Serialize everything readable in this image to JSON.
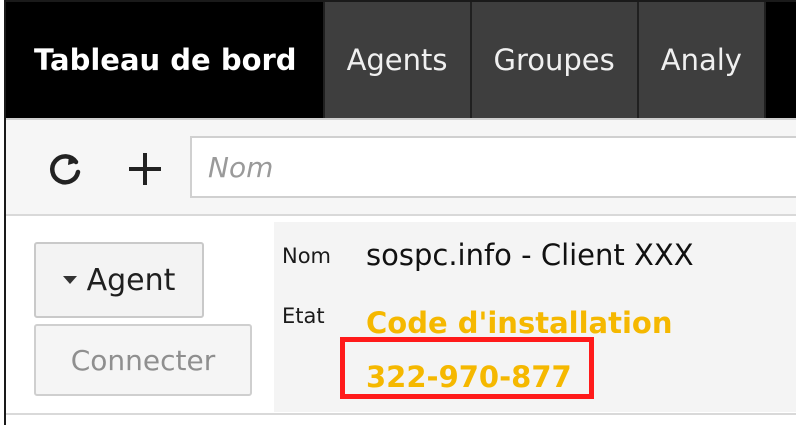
{
  "nav": {
    "tabs": [
      {
        "label": "Tableau de bord",
        "active": true
      },
      {
        "label": "Agents",
        "active": false
      },
      {
        "label": "Groupes",
        "active": false
      },
      {
        "label": "Analy",
        "active": false
      }
    ]
  },
  "toolbar": {
    "refresh_icon": "refresh-icon",
    "add_icon": "plus-icon",
    "search_placeholder": "Nom"
  },
  "agent": {
    "dropdown_label": "Agent",
    "connect_label": "Connecter",
    "name_label": "Nom",
    "name_value": "sospc.info - Client XXX",
    "state_label": "Etat",
    "state_value": "Code d'installation",
    "install_code": "322-970-877"
  },
  "colors": {
    "accent": "#f5b800",
    "highlight": "#ff1a1a",
    "nav_bg": "#000000",
    "tab_bg": "#3e3e3e"
  }
}
